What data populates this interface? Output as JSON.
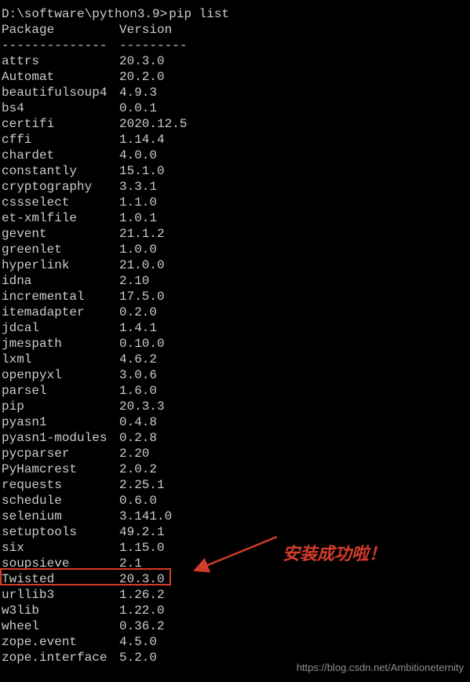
{
  "prompt": {
    "path": "D:\\software\\python3.9",
    "arrow": ">",
    "command": "pip list"
  },
  "header": {
    "package": "Package",
    "version": "Version"
  },
  "divider": {
    "package": "--------------",
    "version": "---------"
  },
  "packages": [
    {
      "name": "attrs",
      "version": "20.3.0"
    },
    {
      "name": "Automat",
      "version": "20.2.0"
    },
    {
      "name": "beautifulsoup4",
      "version": "4.9.3"
    },
    {
      "name": "bs4",
      "version": "0.0.1"
    },
    {
      "name": "certifi",
      "version": "2020.12.5"
    },
    {
      "name": "cffi",
      "version": "1.14.4"
    },
    {
      "name": "chardet",
      "version": "4.0.0"
    },
    {
      "name": "constantly",
      "version": "15.1.0"
    },
    {
      "name": "cryptography",
      "version": "3.3.1"
    },
    {
      "name": "cssselect",
      "version": "1.1.0"
    },
    {
      "name": "et-xmlfile",
      "version": "1.0.1"
    },
    {
      "name": "gevent",
      "version": "21.1.2"
    },
    {
      "name": "greenlet",
      "version": "1.0.0"
    },
    {
      "name": "hyperlink",
      "version": "21.0.0"
    },
    {
      "name": "idna",
      "version": "2.10"
    },
    {
      "name": "incremental",
      "version": "17.5.0"
    },
    {
      "name": "itemadapter",
      "version": "0.2.0"
    },
    {
      "name": "jdcal",
      "version": "1.4.1"
    },
    {
      "name": "jmespath",
      "version": "0.10.0"
    },
    {
      "name": "lxml",
      "version": "4.6.2"
    },
    {
      "name": "openpyxl",
      "version": "3.0.6"
    },
    {
      "name": "parsel",
      "version": "1.6.0"
    },
    {
      "name": "pip",
      "version": "20.3.3"
    },
    {
      "name": "pyasn1",
      "version": "0.4.8"
    },
    {
      "name": "pyasn1-modules",
      "version": "0.2.8"
    },
    {
      "name": "pycparser",
      "version": "2.20"
    },
    {
      "name": "PyHamcrest",
      "version": "2.0.2"
    },
    {
      "name": "requests",
      "version": "2.25.1"
    },
    {
      "name": "schedule",
      "version": "0.6.0"
    },
    {
      "name": "selenium",
      "version": "3.141.0"
    },
    {
      "name": "setuptools",
      "version": "49.2.1"
    },
    {
      "name": "six",
      "version": "1.15.0"
    },
    {
      "name": "soupsieve",
      "version": "2.1"
    },
    {
      "name": "Twisted",
      "version": "20.3.0"
    },
    {
      "name": "urllib3",
      "version": "1.26.2"
    },
    {
      "name": "w3lib",
      "version": "1.22.0"
    },
    {
      "name": "wheel",
      "version": "0.36.2"
    },
    {
      "name": "zope.event",
      "version": "4.5.0"
    },
    {
      "name": "zope.interface",
      "version": "5.2.0"
    }
  ],
  "annotation": "安装成功啦！",
  "watermark": "https://blog.csdn.net/Ambitioneternity"
}
